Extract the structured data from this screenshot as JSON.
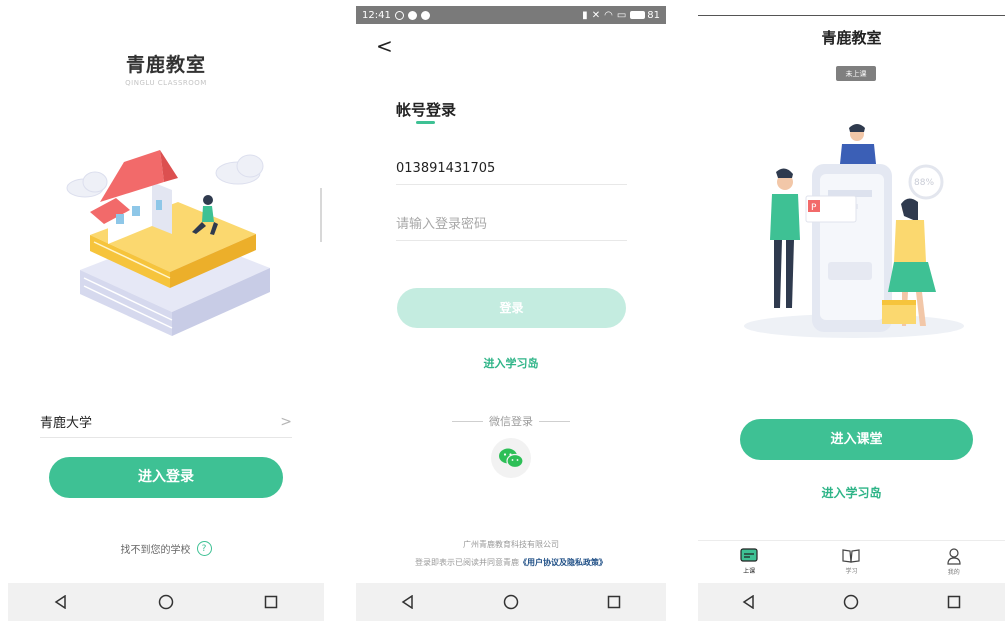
{
  "screen1": {
    "app_title": "青鹿教室",
    "app_subtitle": "QINGLU CLASSROOM",
    "school_name": "青鹿大学",
    "login_button": "进入登录",
    "help_text": "找不到您的学校",
    "help_icon": "?"
  },
  "screen2": {
    "status": {
      "time": "12:41",
      "battery": "81"
    },
    "title": "帐号登录",
    "account_value": "013891431705",
    "password_placeholder": "请输入登录密码",
    "login_button": "登录",
    "study_island_link": "进入学习岛",
    "wechat_label": "微信登录",
    "company": "广州青鹿教育科技有限公司",
    "agreement_prefix": "登录即表示已阅读并同意青鹿",
    "agreement_link": "《用户协议及隐私政策》"
  },
  "screen3": {
    "title": "青鹿教室",
    "badge": "未上课",
    "illustration_text": {
      "percent": "88%"
    },
    "enter_class_button": "进入课堂",
    "study_island_link": "进入学习岛",
    "tabs": [
      {
        "label": "上课",
        "icon": "classroom-icon",
        "active": true
      },
      {
        "label": "学习",
        "icon": "book-icon",
        "active": false
      },
      {
        "label": "我的",
        "icon": "profile-icon",
        "active": false
      }
    ]
  },
  "colors": {
    "accent": "#3ec194",
    "accent_disabled": "#c4ece0",
    "link": "#2eb487",
    "nav_bar": "#f1f1f1",
    "status_bar": "#7a7a7a"
  }
}
